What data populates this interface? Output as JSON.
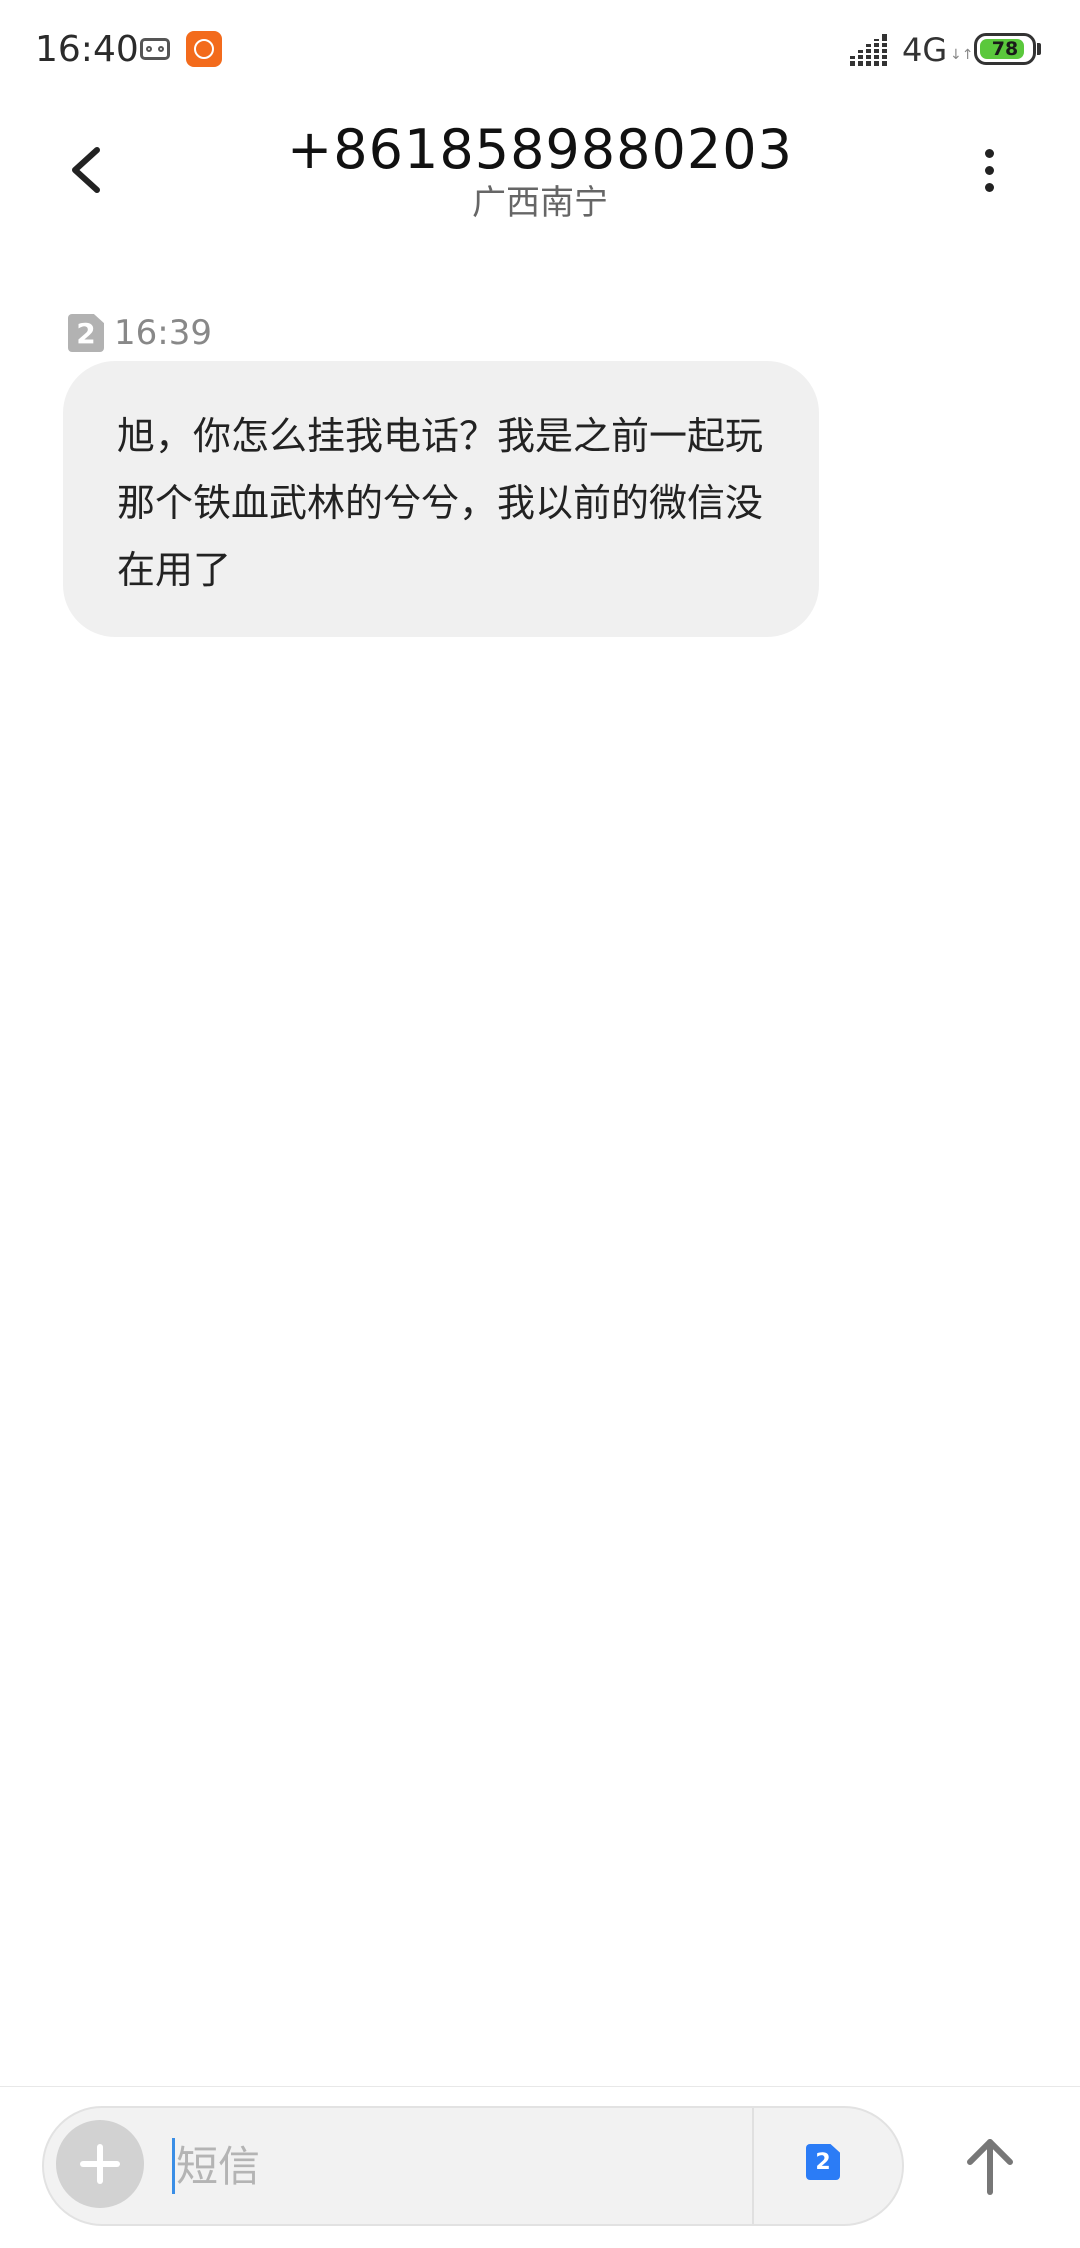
{
  "status_bar": {
    "time": "16:40",
    "network": "4G",
    "data_arrows": "↓↑",
    "battery_level": "78",
    "icons": [
      "voicemail-icon",
      "mi-app-icon",
      "signal-icon",
      "battery-icon"
    ],
    "colors": {
      "mi_app": "#f36b1c",
      "battery_fill": "#5ac83c"
    }
  },
  "header": {
    "title": "+8618589880203",
    "subtitle": "广西南宁",
    "icons": [
      "back-arrow-icon",
      "more-vertical-icon"
    ]
  },
  "conversation": {
    "messages": [
      {
        "sim_slot": "2",
        "time": "16:39",
        "text": "旭，你怎么挂我电话？我是之前一起玩那个铁血武林的兮兮，我以前的微信没在用了"
      }
    ],
    "colors": {
      "bubble": "#f0f0f0"
    }
  },
  "composer": {
    "placeholder": "短信",
    "value": "",
    "sim_slot": "2",
    "icons": [
      "plus-icon",
      "sim-card-icon",
      "send-arrow-icon"
    ],
    "colors": {
      "sim_badge": "#2b7cf6"
    }
  }
}
